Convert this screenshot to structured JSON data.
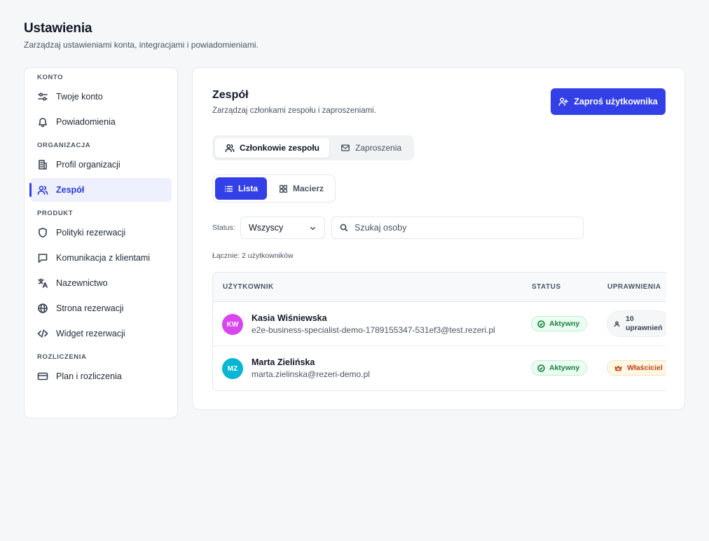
{
  "header": {
    "title": "Ustawienia",
    "subtitle": "Zarządzaj ustawieniami konta, integracjami i powiadomieniami."
  },
  "sidebar": {
    "sections": [
      {
        "label": "KONTO",
        "items": [
          {
            "label": "Twoje konto",
            "icon": "sliders-icon"
          },
          {
            "label": "Powiadomienia",
            "icon": "bell-icon"
          }
        ]
      },
      {
        "label": "ORGANIZACJA",
        "items": [
          {
            "label": "Profil organizacji",
            "icon": "building-icon"
          },
          {
            "label": "Zespół",
            "icon": "users-icon",
            "active": true
          }
        ]
      },
      {
        "label": "PRODUKT",
        "items": [
          {
            "label": "Polityki rezerwacji",
            "icon": "shield-icon"
          },
          {
            "label": "Komunikacja z klientami",
            "icon": "message-icon"
          },
          {
            "label": "Nazewnictwo",
            "icon": "translate-icon"
          },
          {
            "label": "Strona rezerwacji",
            "icon": "globe-icon"
          },
          {
            "label": "Widget rezerwacji",
            "icon": "code-icon"
          }
        ]
      },
      {
        "label": "ROZLICZENIA",
        "items": [
          {
            "label": "Plan i rozliczenia",
            "icon": "credit-card-icon"
          }
        ]
      }
    ]
  },
  "main": {
    "title": "Zespół",
    "description": "Zarządzaj członkami zespołu i zaproszeniami.",
    "invite_button": "Zaproś użytkownika",
    "tabs": [
      {
        "label": "Członkowie zespołu",
        "active": true
      },
      {
        "label": "Zaproszenia",
        "active": false
      }
    ],
    "views": [
      {
        "label": "Lista",
        "active": true
      },
      {
        "label": "Macierz",
        "active": false
      }
    ],
    "filter": {
      "label": "Status:",
      "selected": "Wszyscy",
      "search_placeholder": "Szukaj osoby"
    },
    "total": "Łącznie: 2 użytkowników",
    "table": {
      "columns": [
        "UŻYTKOWNIK",
        "STATUS",
        "UPRAWNIENIA"
      ],
      "rows": [
        {
          "initials": "KW",
          "avatar_color": "#d946ef",
          "name": "Kasia Wiśniewska",
          "email": "e2e-business-specialist-demo-1789155347-531ef3@test.rezeri.pl",
          "status": "Aktywny",
          "permissions": "10 uprawnień"
        },
        {
          "initials": "MZ",
          "avatar_color": "#06b6d4",
          "name": "Marta Zielińska",
          "email": "marta.zielinska@rezeri-demo.pl",
          "status": "Aktywny",
          "permissions": "Właściciel"
        }
      ]
    }
  },
  "colors": {
    "accent": "#3340e8",
    "success": "#15803d",
    "owner": "#c2410c"
  }
}
